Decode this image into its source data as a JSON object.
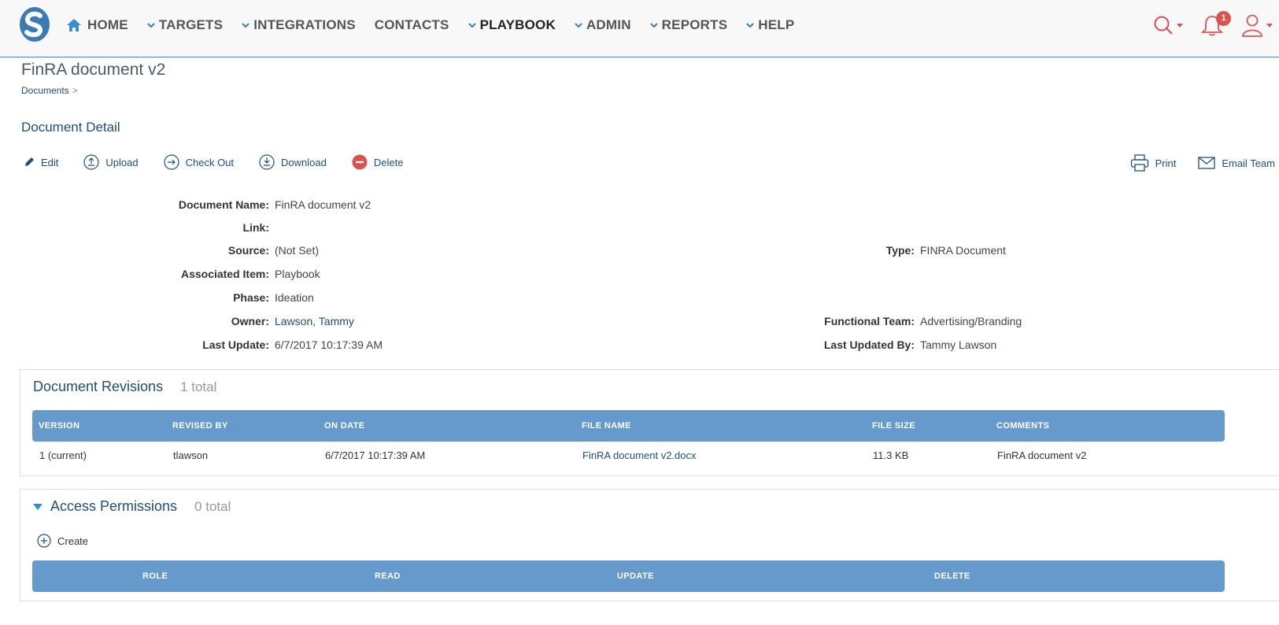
{
  "nav": {
    "items": [
      {
        "label": "HOME"
      },
      {
        "label": "TARGETS"
      },
      {
        "label": "INTEGRATIONS"
      },
      {
        "label": "CONTACTS"
      },
      {
        "label": "PLAYBOOK"
      },
      {
        "label": "ADMIN"
      },
      {
        "label": "REPORTS"
      },
      {
        "label": "HELP"
      }
    ],
    "notification_count": "1"
  },
  "page": {
    "title": "FinRA document v2",
    "breadcrumb": "Documents",
    "breadcrumb_sep": ">",
    "section_title": "Document Detail"
  },
  "toolbar": {
    "edit": "Edit",
    "upload": "Upload",
    "check_out": "Check Out",
    "download": "Download",
    "delete": "Delete",
    "print": "Print",
    "email_team": "Email Team"
  },
  "details": {
    "document_name_label": "Document Name:",
    "document_name": "FinRA document v2",
    "link_label": "Link:",
    "link": "",
    "source_label": "Source:",
    "source": "(Not Set)",
    "type_label": "Type:",
    "type": "FINRA Document",
    "associated_item_label": "Associated Item:",
    "associated_item": "Playbook",
    "phase_label": "Phase:",
    "phase": "Ideation",
    "owner_label": "Owner:",
    "owner": "Lawson, Tammy",
    "functional_team_label": "Functional Team:",
    "functional_team": "Advertising/Branding",
    "last_update_label": "Last Update:",
    "last_update": "6/7/2017 10:17:39 AM",
    "last_updated_by_label": "Last Updated By:",
    "last_updated_by": "Tammy Lawson"
  },
  "revisions": {
    "title": "Document Revisions",
    "total": "1 total",
    "columns": [
      "VERSION",
      "REVISED BY",
      "ON DATE",
      "FILE NAME",
      "FILE SIZE",
      "COMMENTS"
    ],
    "rows": [
      {
        "version": "1 (current)",
        "revised_by": "tlawson",
        "on_date": "6/7/2017 10:17:39 AM",
        "file_name": "FinRA document v2.docx",
        "file_size": "11.3 KB",
        "comments": "FinRA document v2"
      }
    ]
  },
  "permissions": {
    "title": "Access Permissions",
    "total": "0 total",
    "create": "Create",
    "columns": [
      "ROLE",
      "READ",
      "UPDATE",
      "DELETE"
    ]
  },
  "colors": {
    "accent": "#1f4e79",
    "table_header": "#6699cc",
    "alert": "#d9534f",
    "nav_blue": "#2f8fcf"
  }
}
